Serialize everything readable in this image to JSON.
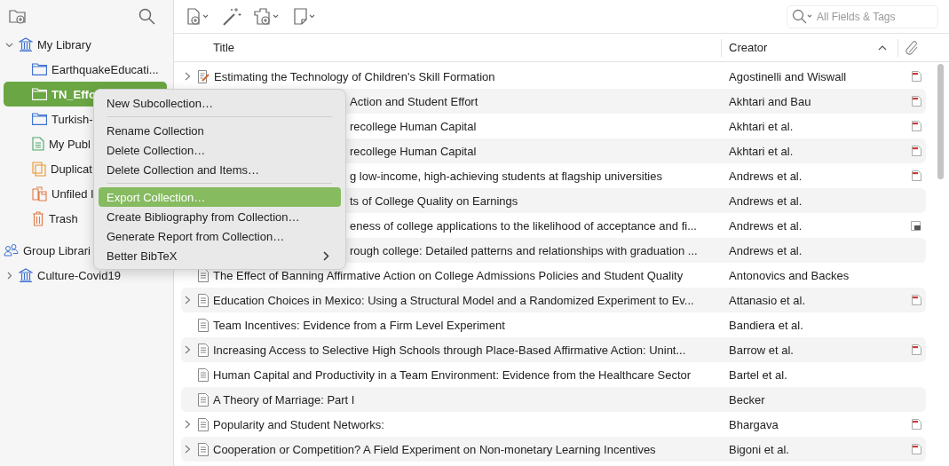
{
  "toolbar": {
    "search": {
      "placeholder": "All Fields & Tags"
    }
  },
  "sidebar": {
    "libraries": [
      {
        "label": "My Library",
        "kind": "library",
        "expanded": true,
        "children": [
          {
            "label": "EarthquakeEducati...",
            "kind": "folder",
            "selected": false
          },
          {
            "label": "TN_Effo",
            "kind": "folder",
            "selected": true
          },
          {
            "label": "Turkish-",
            "kind": "folder",
            "selected": false
          },
          {
            "label": "My Publ",
            "kind": "publications",
            "selected": false
          },
          {
            "label": "Duplicat",
            "kind": "duplicates",
            "selected": false
          },
          {
            "label": "Unfiled I",
            "kind": "unfiled",
            "selected": false
          },
          {
            "label": "Trash",
            "kind": "trash",
            "selected": false
          }
        ]
      },
      {
        "label": "Group Librari",
        "kind": "group"
      },
      {
        "label": "Culture-Covid19",
        "kind": "library",
        "expanded": false
      }
    ]
  },
  "context_menu": {
    "groups": [
      [
        {
          "label": "New Subcollection…",
          "selected": false,
          "submenu": false
        }
      ],
      [
        {
          "label": "Rename Collection",
          "selected": false,
          "submenu": false
        },
        {
          "label": "Delete Collection…",
          "selected": false,
          "submenu": false
        },
        {
          "label": "Delete Collection and Items…",
          "selected": false,
          "submenu": false
        }
      ],
      [
        {
          "label": "Export Collection…",
          "selected": true,
          "submenu": false
        },
        {
          "label": "Create Bibliography from Collection…",
          "selected": false,
          "submenu": false
        },
        {
          "label": "Generate Report from Collection…",
          "selected": false,
          "submenu": false
        },
        {
          "label": "Better BibTeX",
          "selected": false,
          "submenu": true
        }
      ]
    ]
  },
  "table": {
    "columns": [
      "Title",
      "Creator"
    ],
    "rows": [
      {
        "title": "Estimating the Technology of Children's Skill Formation",
        "creator": "Agostinelli and Wiswall",
        "covered": false,
        "children": true,
        "kind": "journal",
        "attachment": {
          "kind": "pdf"
        }
      },
      {
        "title": "Action and Student Effort",
        "creator": "Akhtari and Bau",
        "covered": true,
        "attachment": {
          "kind": "pdf"
        }
      },
      {
        "title": "recollege Human Capital",
        "creator": "Akhtari et al.",
        "covered": true,
        "attachment": {
          "kind": "pdf"
        }
      },
      {
        "title": "recollege Human Capital",
        "creator": "Akhtari et al.",
        "covered": true,
        "attachment": {
          "kind": "pdf"
        }
      },
      {
        "title": "g low-income, high-achieving students at flagship universities",
        "creator": "Andrews et al.",
        "covered": true,
        "attachment": {
          "kind": "pdf"
        }
      },
      {
        "title": "ts of College Quality on Earnings",
        "creator": "Andrews et al.",
        "covered": true
      },
      {
        "title": "eness of college applications to the likelihood of acceptance and fi...",
        "creator": "Andrews et al.",
        "covered": true,
        "attachment": {
          "kind": "snapshot"
        }
      },
      {
        "title": "rough college: Detailed patterns and relationships with graduation ...",
        "creator": "Andrews et al.",
        "covered": true
      },
      {
        "title": "The Effect of Banning Affirmative Action on College Admissions Policies and Student Quality",
        "creator": "Antonovics and Backes",
        "covered": false,
        "children": false,
        "kind": "document"
      },
      {
        "title": "Education Choices in Mexico: Using a Structural Model and a Randomized Experiment to Ev...",
        "creator": "Attanasio et al.",
        "covered": false,
        "children": true,
        "kind": "document",
        "attachment": {
          "kind": "pdf"
        }
      },
      {
        "title": "Team Incentives: Evidence from a Firm Level Experiment",
        "creator": "Bandiera et al.",
        "covered": false,
        "children": false,
        "kind": "document"
      },
      {
        "title": "Increasing Access to Selective High Schools through Place-Based Affirmative Action: Unint...",
        "creator": "Barrow et al.",
        "covered": false,
        "children": true,
        "kind": "document",
        "attachment": {
          "kind": "pdf"
        }
      },
      {
        "title": "Human Capital and Productivity in a Team Environment: Evidence from the Healthcare Sector",
        "creator": "Bartel et al.",
        "covered": false,
        "children": false,
        "kind": "document"
      },
      {
        "title": "A Theory of Marriage: Part I",
        "creator": "Becker",
        "covered": false,
        "children": false,
        "kind": "document"
      },
      {
        "title": "Popularity and Student Networks:",
        "creator": "Bhargava",
        "covered": false,
        "children": true,
        "kind": "document",
        "attachment": {
          "kind": "pdf"
        }
      },
      {
        "title": "Cooperation or Competition? A Field Experiment on Non-monetary Learning Incentives",
        "creator": "Bigoni et al.",
        "covered": false,
        "children": true,
        "kind": "document",
        "attachment": {
          "kind": "pdf"
        }
      }
    ]
  }
}
